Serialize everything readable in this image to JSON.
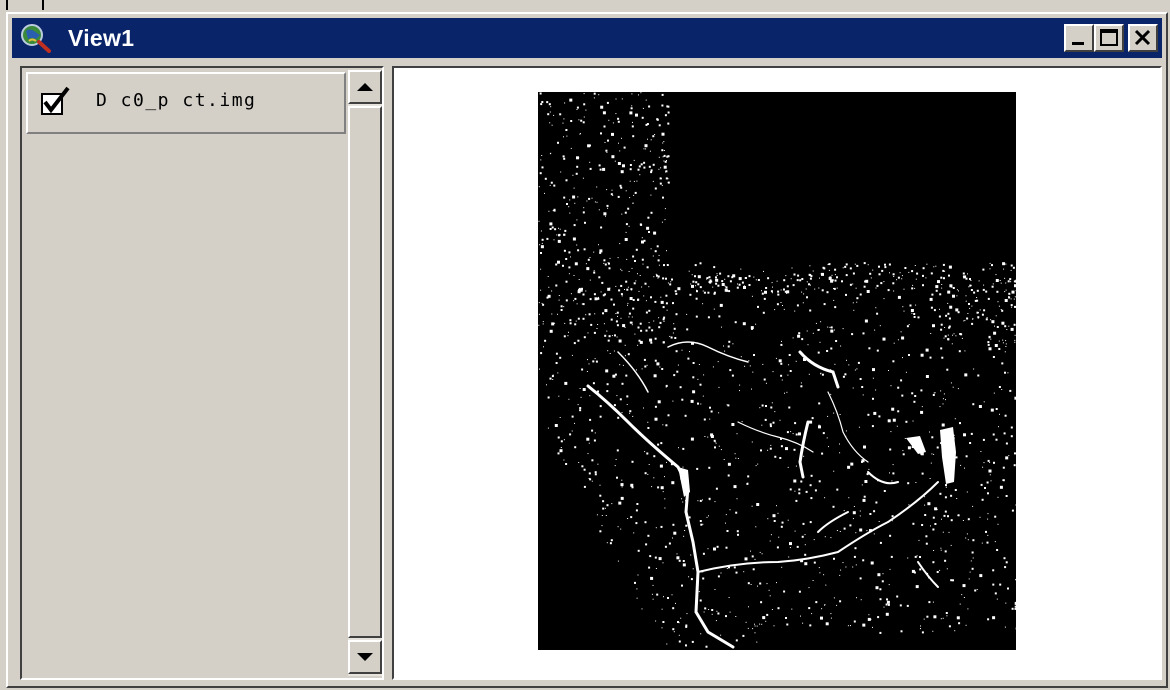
{
  "window": {
    "title": "View1",
    "icon": "globe-magnifier-icon",
    "buttons": {
      "minimize": "minimize-icon",
      "maximize": "maximize-icon",
      "close": "close-icon"
    }
  },
  "toc": {
    "layers": [
      {
        "name": "D c0_p ct.img",
        "visible": true
      }
    ]
  },
  "map": {
    "layer_background": "#000000",
    "feature_color": "#ffffff"
  },
  "colors": {
    "titlebar": "#0a246a",
    "chrome": "#d4d0c8",
    "canvas": "#ffffff"
  }
}
